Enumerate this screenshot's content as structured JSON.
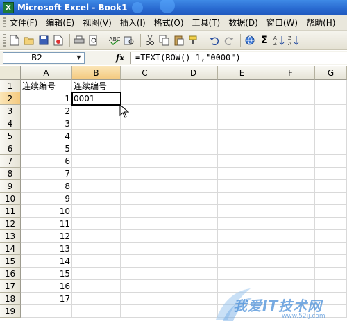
{
  "window": {
    "title": "Microsoft Excel - Book1",
    "app_icon": "excel-icon"
  },
  "menu": {
    "items": [
      "文件(F)",
      "编辑(E)",
      "视图(V)",
      "插入(I)",
      "格式(O)",
      "工具(T)",
      "数据(D)",
      "窗口(W)",
      "帮助(H)"
    ]
  },
  "toolbar": {
    "icons": [
      "new-icon",
      "open-icon",
      "save-icon",
      "permission-icon",
      "print-icon",
      "print-preview-icon",
      "spelling-icon",
      "research-icon",
      "cut-icon",
      "copy-icon",
      "paste-icon",
      "format-painter-icon",
      "undo-icon",
      "redo-icon",
      "hyperlink-icon",
      "autosum-icon",
      "sort-ascending-icon",
      "sort-descending-icon"
    ],
    "autosum_glyph": "Σ"
  },
  "formula_bar": {
    "name_box": "B2",
    "fx_label": "fx",
    "formula": "=TEXT(ROW()-1,\"0000\")"
  },
  "sheet": {
    "columns": [
      "A",
      "B",
      "C",
      "D",
      "E",
      "F",
      "G"
    ],
    "active_column": "B",
    "active_row": "2",
    "rows": [
      {
        "num": "1",
        "A": "连续编号",
        "B": "连续编号"
      },
      {
        "num": "2",
        "A": "1",
        "B": "0001"
      },
      {
        "num": "3",
        "A": "2",
        "B": ""
      },
      {
        "num": "4",
        "A": "3",
        "B": ""
      },
      {
        "num": "5",
        "A": "4",
        "B": ""
      },
      {
        "num": "6",
        "A": "5",
        "B": ""
      },
      {
        "num": "7",
        "A": "6",
        "B": ""
      },
      {
        "num": "8",
        "A": "7",
        "B": ""
      },
      {
        "num": "9",
        "A": "8",
        "B": ""
      },
      {
        "num": "10",
        "A": "9",
        "B": ""
      },
      {
        "num": "11",
        "A": "10",
        "B": ""
      },
      {
        "num": "12",
        "A": "11",
        "B": ""
      },
      {
        "num": "13",
        "A": "12",
        "B": ""
      },
      {
        "num": "14",
        "A": "13",
        "B": ""
      },
      {
        "num": "15",
        "A": "14",
        "B": ""
      },
      {
        "num": "16",
        "A": "15",
        "B": ""
      },
      {
        "num": "17",
        "A": "16",
        "B": ""
      },
      {
        "num": "18",
        "A": "17",
        "B": ""
      },
      {
        "num": "19",
        "A": "",
        "B": ""
      }
    ]
  },
  "watermark": {
    "text": "我爱IT技术网",
    "sub": "www.52ij.com"
  }
}
